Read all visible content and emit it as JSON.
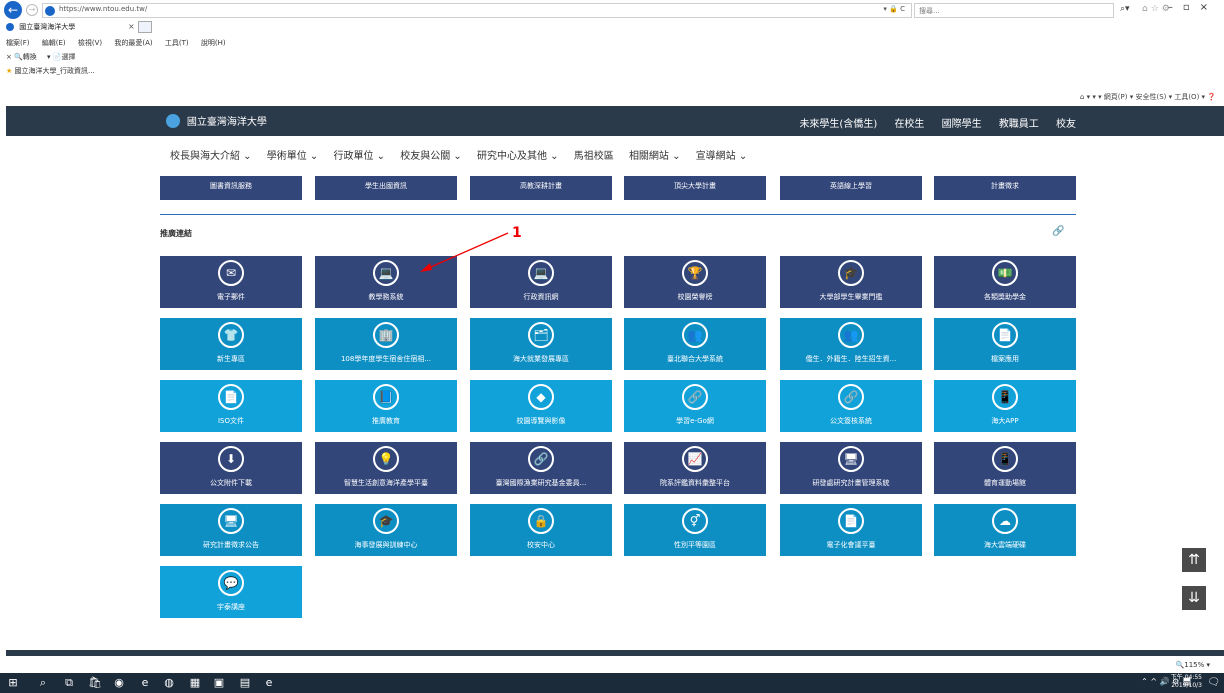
{
  "browser": {
    "url": "https://www.ntou.edu.tw/",
    "tab_title": "國立臺灣海洋大學",
    "address_actions": "▾ 🔒 C",
    "search_placeholder": "搜尋...",
    "menu": [
      "檔案(F)",
      "編輯(E)",
      "檢視(V)",
      "我的最愛(A)",
      "工具(T)",
      "說明(H)"
    ],
    "cmdbar": [
      "× 🔍轉換",
      "▾ 📄選擇"
    ],
    "favorite": "國立海洋大學_行政資訊...",
    "toolbar_right": "▾ ▾ ▾ 網頁(P) ▾ 安全性(S) ▾ 工具(O) ▾"
  },
  "header": {
    "logo_text": "國立臺灣海洋大學",
    "top_links": [
      "未來學生(含僑生)",
      "在校生",
      "國際學生",
      "教職員工",
      "校友"
    ]
  },
  "nav": {
    "items": [
      "校長與海大介紹 ⌄",
      "學術單位 ⌄",
      "行政單位 ⌄",
      "校友與公關 ⌄",
      "研究中心及其他 ⌄",
      "馬祖校區",
      "相關網站 ⌄",
      "宣導網站 ⌄"
    ]
  },
  "top_row": [
    "圖書資訊服務",
    "學生出國資訊",
    "高教深耕計畫",
    "頂尖大學計畫",
    "英語線上學習",
    "計畫徵求"
  ],
  "section": {
    "title": "推廣連結"
  },
  "tiles": [
    {
      "label": "電子郵件",
      "icon": "✉",
      "color": "navy"
    },
    {
      "label": "教學務系統",
      "icon": "💻",
      "color": "navy"
    },
    {
      "label": "行政資訊網",
      "icon": "💻",
      "color": "navy"
    },
    {
      "label": "校園榮譽榜",
      "icon": "🏆",
      "color": "navy"
    },
    {
      "label": "大學部學生畢業門檻",
      "icon": "🎓",
      "color": "navy"
    },
    {
      "label": "各類獎助學金",
      "icon": "💵",
      "color": "navy"
    },
    {
      "label": "新生專區",
      "icon": "👕",
      "color": "blue"
    },
    {
      "label": "108學年度學生宿舍住宿相...",
      "icon": "🏢",
      "color": "blue"
    },
    {
      "label": "海大就業發展專區",
      "icon": "🗂",
      "color": "blue"
    },
    {
      "label": "臺北聯合大學系統",
      "icon": "👥",
      "color": "blue"
    },
    {
      "label": "僑生．外籍生．陸生招生資...",
      "icon": "👥",
      "color": "blue"
    },
    {
      "label": "檔案應用",
      "icon": "📄",
      "color": "blue"
    },
    {
      "label": "ISO文件",
      "icon": "📄",
      "color": "cyan"
    },
    {
      "label": "推廣教育",
      "icon": "📘",
      "color": "cyan"
    },
    {
      "label": "校園導覽與影像",
      "icon": "◆",
      "color": "cyan"
    },
    {
      "label": "學習e-Go網",
      "icon": "🔗",
      "color": "cyan"
    },
    {
      "label": "公文簽核系統",
      "icon": "🔗",
      "color": "cyan"
    },
    {
      "label": "海大APP",
      "icon": "📱",
      "color": "cyan"
    },
    {
      "label": "公文附件下載",
      "icon": "⬇",
      "color": "navy"
    },
    {
      "label": "智慧生活創意海洋產學平臺",
      "icon": "💡",
      "color": "navy"
    },
    {
      "label": "臺灣國際漁業研究基金委員...",
      "icon": "🔗",
      "color": "navy"
    },
    {
      "label": "院系評鑑資料彙整平台",
      "icon": "📈",
      "color": "navy"
    },
    {
      "label": "研發處研究計畫管理系統",
      "icon": "🖥",
      "color": "navy"
    },
    {
      "label": "體育運動場館",
      "icon": "📱",
      "color": "navy"
    },
    {
      "label": "研究計畫徵求公告",
      "icon": "🖥",
      "color": "blue"
    },
    {
      "label": "海事發展與訓練中心",
      "icon": "🎓",
      "color": "blue"
    },
    {
      "label": "校安中心",
      "icon": "🔒",
      "color": "blue"
    },
    {
      "label": "性別平等園區",
      "icon": "⚥",
      "color": "blue"
    },
    {
      "label": "電子化會議平臺",
      "icon": "📄",
      "color": "blue"
    },
    {
      "label": "海大雲端硬碟",
      "icon": "☁",
      "color": "blue"
    },
    {
      "label": "宇泰講座",
      "icon": "💬",
      "color": "cyan"
    }
  ],
  "annotation": {
    "number": "1"
  },
  "status": {
    "zoom": "🔍115% ▾"
  },
  "taskbar": {
    "clock_time": "下午 04:55",
    "clock_date": "2019/10/3",
    "tray": "⌃ ^ 🔊 ⚙ 🖥"
  }
}
